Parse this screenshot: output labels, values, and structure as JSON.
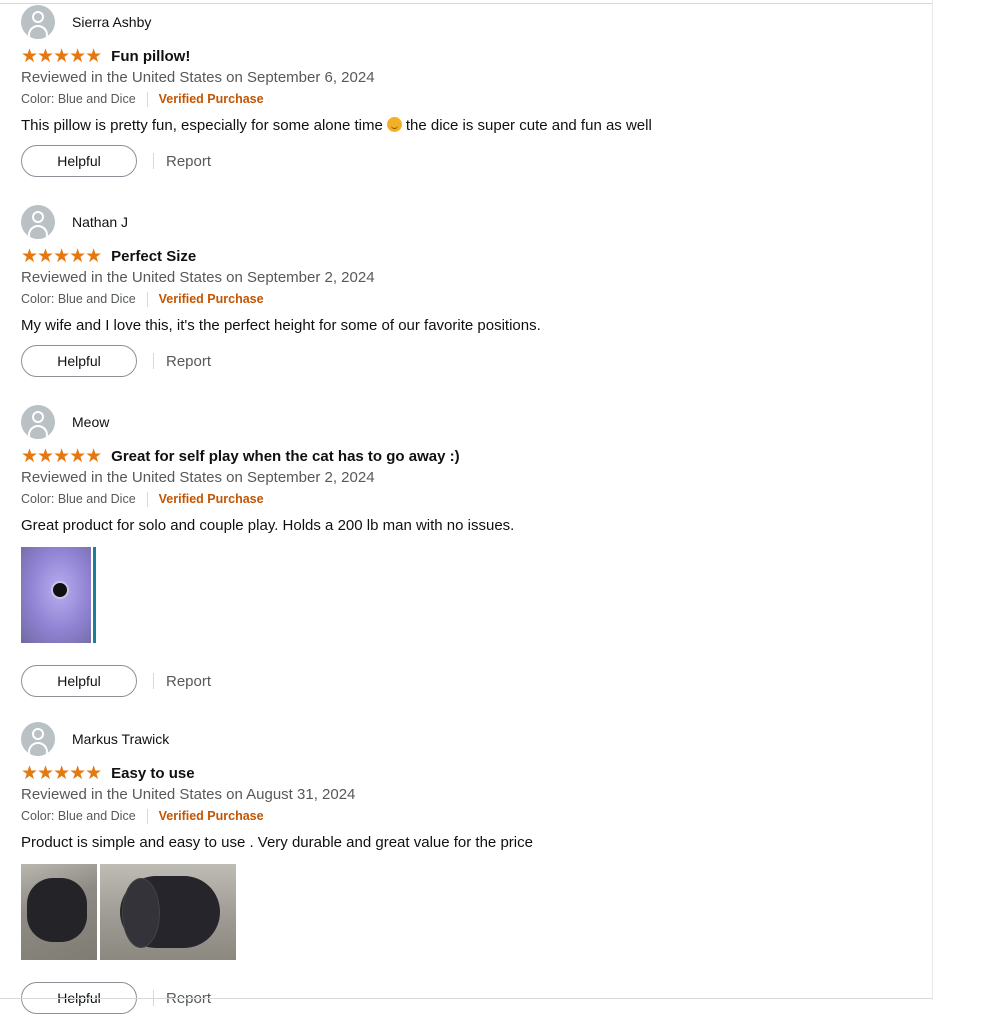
{
  "reviews": [
    {
      "name": "Sierra Ashby",
      "stars": "★★★★★",
      "title": "Fun pillow!",
      "date": "Reviewed in the United States on September 6, 2024",
      "color": "Color: Blue and Dice",
      "verified": "Verified Purchase",
      "body_before": "This pillow is pretty fun, especially for some alone time",
      "body_after": "the dice is super cute and fun as well",
      "helpful": "Helpful",
      "report": "Report"
    },
    {
      "name": "Nathan J",
      "stars": "★★★★★",
      "title": "Perfect Size",
      "date": "Reviewed in the United States on September 2, 2024",
      "color": "Color: Blue and Dice",
      "verified": "Verified Purchase",
      "body": "My wife and I love this, it's the perfect height for some of our favorite positions.",
      "helpful": "Helpful",
      "report": "Report"
    },
    {
      "name": "Meow",
      "stars": "★★★★★",
      "title": "Great for self play when the cat has to go away :)",
      "date": "Reviewed in the United States on September 2, 2024",
      "color": "Color: Blue and Dice",
      "verified": "Verified Purchase",
      "body": "Great product for solo and couple play. Holds a 200 lb man with no issues.",
      "helpful": "Helpful",
      "report": "Report"
    },
    {
      "name": "Markus Trawick",
      "stars": "★★★★★",
      "title": "Easy to use",
      "date": "Reviewed in the United States on August 31, 2024",
      "color": "Color: Blue and Dice",
      "verified": "Verified Purchase",
      "body": "Product is simple and easy to use . Very durable and great value for the price",
      "helpful": "Helpful",
      "report": "Report"
    }
  ],
  "colors": {
    "star": "#e47911",
    "verified": "#c45500",
    "muted_text": "#565959",
    "primary_text": "#0f1111"
  }
}
